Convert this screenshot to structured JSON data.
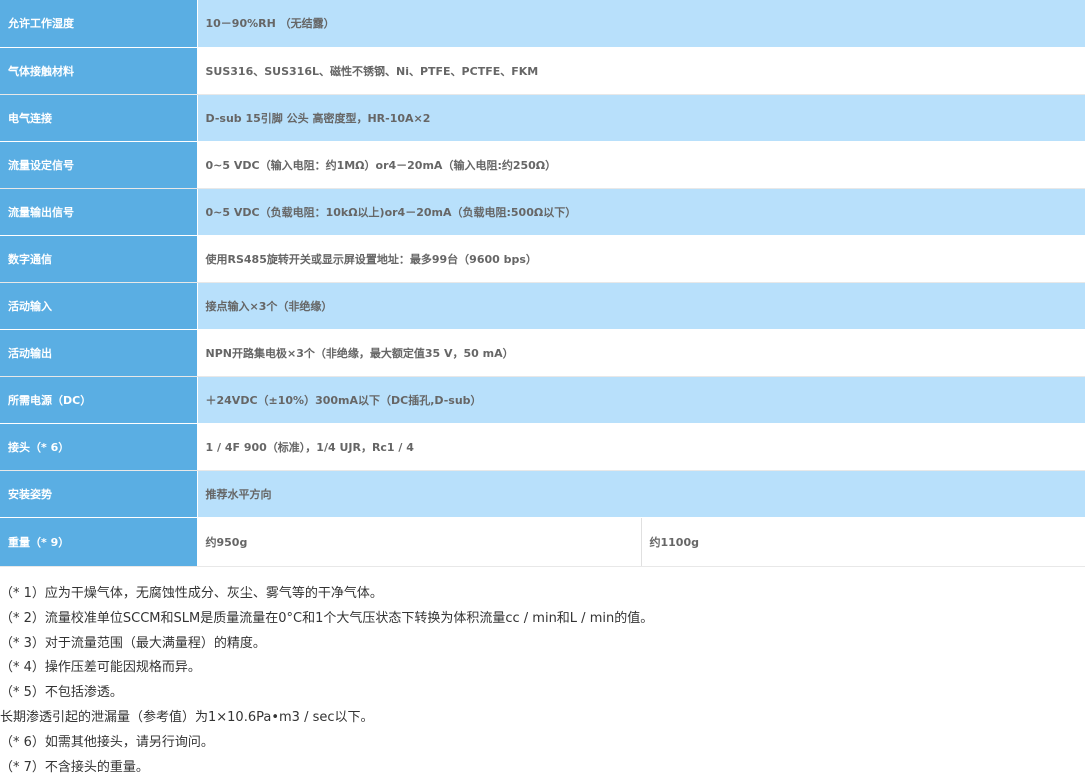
{
  "specs": [
    {
      "label": "允许工作湿度",
      "value": "10－90%RH （无结露）"
    },
    {
      "label": "气体接触材料",
      "value": "SUS316、SUS316L、磁性不锈钢、Ni、PTFE、PCTFE、FKM"
    },
    {
      "label": "电气连接",
      "value": "D-sub 15引脚 公头 高密度型，HR-10A×2"
    },
    {
      "label": "流量设定信号",
      "value": "0~5 VDC（输入电阻：约1MΩ）or4－20mA（输入电阻:约250Ω）"
    },
    {
      "label": "流量输出信号",
      "value": "0~5 VDC（负载电阻：10kΩ以上)or4－20mA（负载电阻:500Ω以下）"
    },
    {
      "label": "数字通信",
      "value": "使用RS485旋转开关或显示屏设置地址：最多99台（9600 bps）"
    },
    {
      "label": "活动输入",
      "value": "接点输入×3个（非绝缘）"
    },
    {
      "label": "活动输出",
      "value": "NPN开路集电极×3个（非绝缘，最大额定值35 V，50 mA）"
    },
    {
      "label": "所需电源（DC）",
      "value": "＋24VDC（±10%）300mA以下（DC插孔,D-sub）"
    },
    {
      "label": "接头（* 6）",
      "value": "1 / 4F 900（标准），1/4 UJR，Rc1 / 4"
    },
    {
      "label": "安装姿势",
      "value": "推荐水平方向"
    }
  ],
  "weight": {
    "label": "重量（* 9）",
    "value_a": "约950g",
    "value_b": "约1100g"
  },
  "notes": [
    "（* 1）应为干燥气体，无腐蚀性成分、灰尘、雾气等的干净气体。",
    "（* 2）流量校准单位SCCM和SLM是质量流量在0°C和1个大气压状态下转换为体积流量cc / min和L / min的值。",
    "（* 3）对于流量范围（最大满量程）的精度。",
    "（* 4）操作压差可能因规格而异。",
    "（* 5）不包括渗透。",
    "长期渗透引起的泄漏量（参考值）为1×10.6Pa•m3 / sec以下。",
    "（* 6）如需其他接头，请另行询问。",
    "（* 7）不含接头的重量。"
  ]
}
